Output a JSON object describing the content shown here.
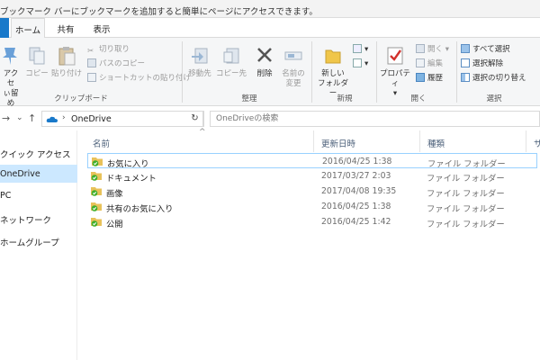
{
  "bookmark_bar": {
    "text": "ブックマーク バーにブックマークを追加すると簡単にページにアクセスできます。"
  },
  "tabs": [
    {
      "label": "ホーム"
    },
    {
      "label": "共有"
    },
    {
      "label": "表示"
    }
  ],
  "ribbon": {
    "clipboard": {
      "access_line1": "アクセ",
      "access_line2": "ぃ留め",
      "copy": "コピー",
      "paste": "貼り付け",
      "cut": "切り取り",
      "copy_path": "パスのコピー",
      "paste_shortcut": "ショートカットの貼り付け",
      "label": "クリップボード"
    },
    "organize": {
      "move_to": "移動先",
      "copy_to": "コピー先",
      "delete": "削除",
      "rename_line1": "名前の",
      "rename_line2": "変更",
      "label": "整理"
    },
    "new": {
      "new_folder_line1": "新しい",
      "new_folder_line2": "フォルダー",
      "label": "新規"
    },
    "open": {
      "properties": "プロパティ",
      "open": "開く",
      "edit": "編集",
      "history": "履歴",
      "label": "開く"
    },
    "select": {
      "select_all": "すべて選択",
      "select_none": "選択解除",
      "invert": "選択の切り替え",
      "label": "選択"
    }
  },
  "address": {
    "path": "OneDrive",
    "search_placeholder": "OneDriveの検索"
  },
  "navpane": {
    "items": [
      {
        "label": "クイック アクセス"
      },
      {
        "label": "OneDrive"
      },
      {
        "label": "PC"
      },
      {
        "label": "ネットワーク"
      },
      {
        "label": "ホームグループ"
      }
    ]
  },
  "filelist": {
    "columns": {
      "name": "名前",
      "date": "更新日時",
      "type": "種類",
      "size": "サ"
    },
    "rows": [
      {
        "name": "お気に入り",
        "date": "2016/04/25 1:38",
        "type": "ファイル フォルダー"
      },
      {
        "name": "ドキュメント",
        "date": "2017/03/27 2:03",
        "type": "ファイル フォルダー"
      },
      {
        "name": "画像",
        "date": "2017/04/08 19:35",
        "type": "ファイル フォルダー"
      },
      {
        "name": "共有のお気に入り",
        "date": "2016/04/25 1:38",
        "type": "ファイル フォルダー"
      },
      {
        "name": "公開",
        "date": "2016/04/25 1:42",
        "type": "ファイル フォルダー"
      }
    ]
  },
  "colors": {
    "accent": "#1979ca",
    "selected_nav": "#cce8ff",
    "folder": "#e8c25a",
    "sync_ok": "#3fae2a"
  }
}
